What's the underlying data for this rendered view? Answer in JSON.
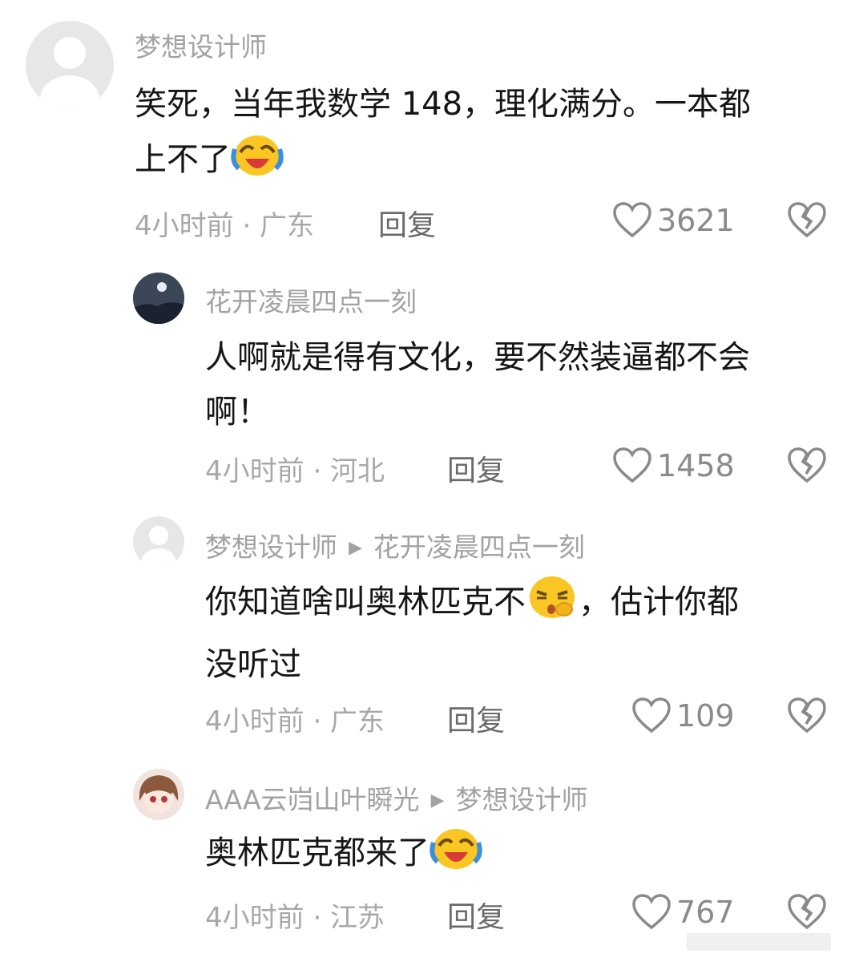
{
  "comments": [
    {
      "user": "梦想设计师",
      "text_lines": [
        "笑死，当年我数学 148，理化满分。一本都",
        "上不了"
      ],
      "meta": "4小时前 · 广东",
      "reply": "回复",
      "likes": "3621",
      "emoji": "laugh-cry-emoji"
    },
    {
      "user": "花开凌晨四点一刻",
      "text_lines": [
        "人啊就是得有文化，要不然装逼都不会",
        "啊！"
      ],
      "meta": "4小时前 · 河北",
      "reply": "回复",
      "likes": "1458"
    },
    {
      "user": "梦想设计师",
      "reply_to": "花开凌晨四点一刻",
      "text_lines": [
        "你知道啥叫奥林匹克不",
        "，估计你都",
        "没听过"
      ],
      "meta": "4小时前 · 广东",
      "reply": "回复",
      "likes": "109",
      "emoji": "thinking-emoji"
    },
    {
      "user": "AAA云岿山叶瞬光",
      "reply_to": "梦想设计师",
      "text_lines": [
        "奥林匹克都来了"
      ],
      "meta": "4小时前 · 江苏",
      "reply": "回复",
      "likes": "767",
      "emoji": "laugh-cry-emoji"
    }
  ],
  "colors": {
    "text": "#161616",
    "meta": "#a8a8a8",
    "name": "#a2a2a2",
    "emoji_yellow": "#f9c623"
  }
}
